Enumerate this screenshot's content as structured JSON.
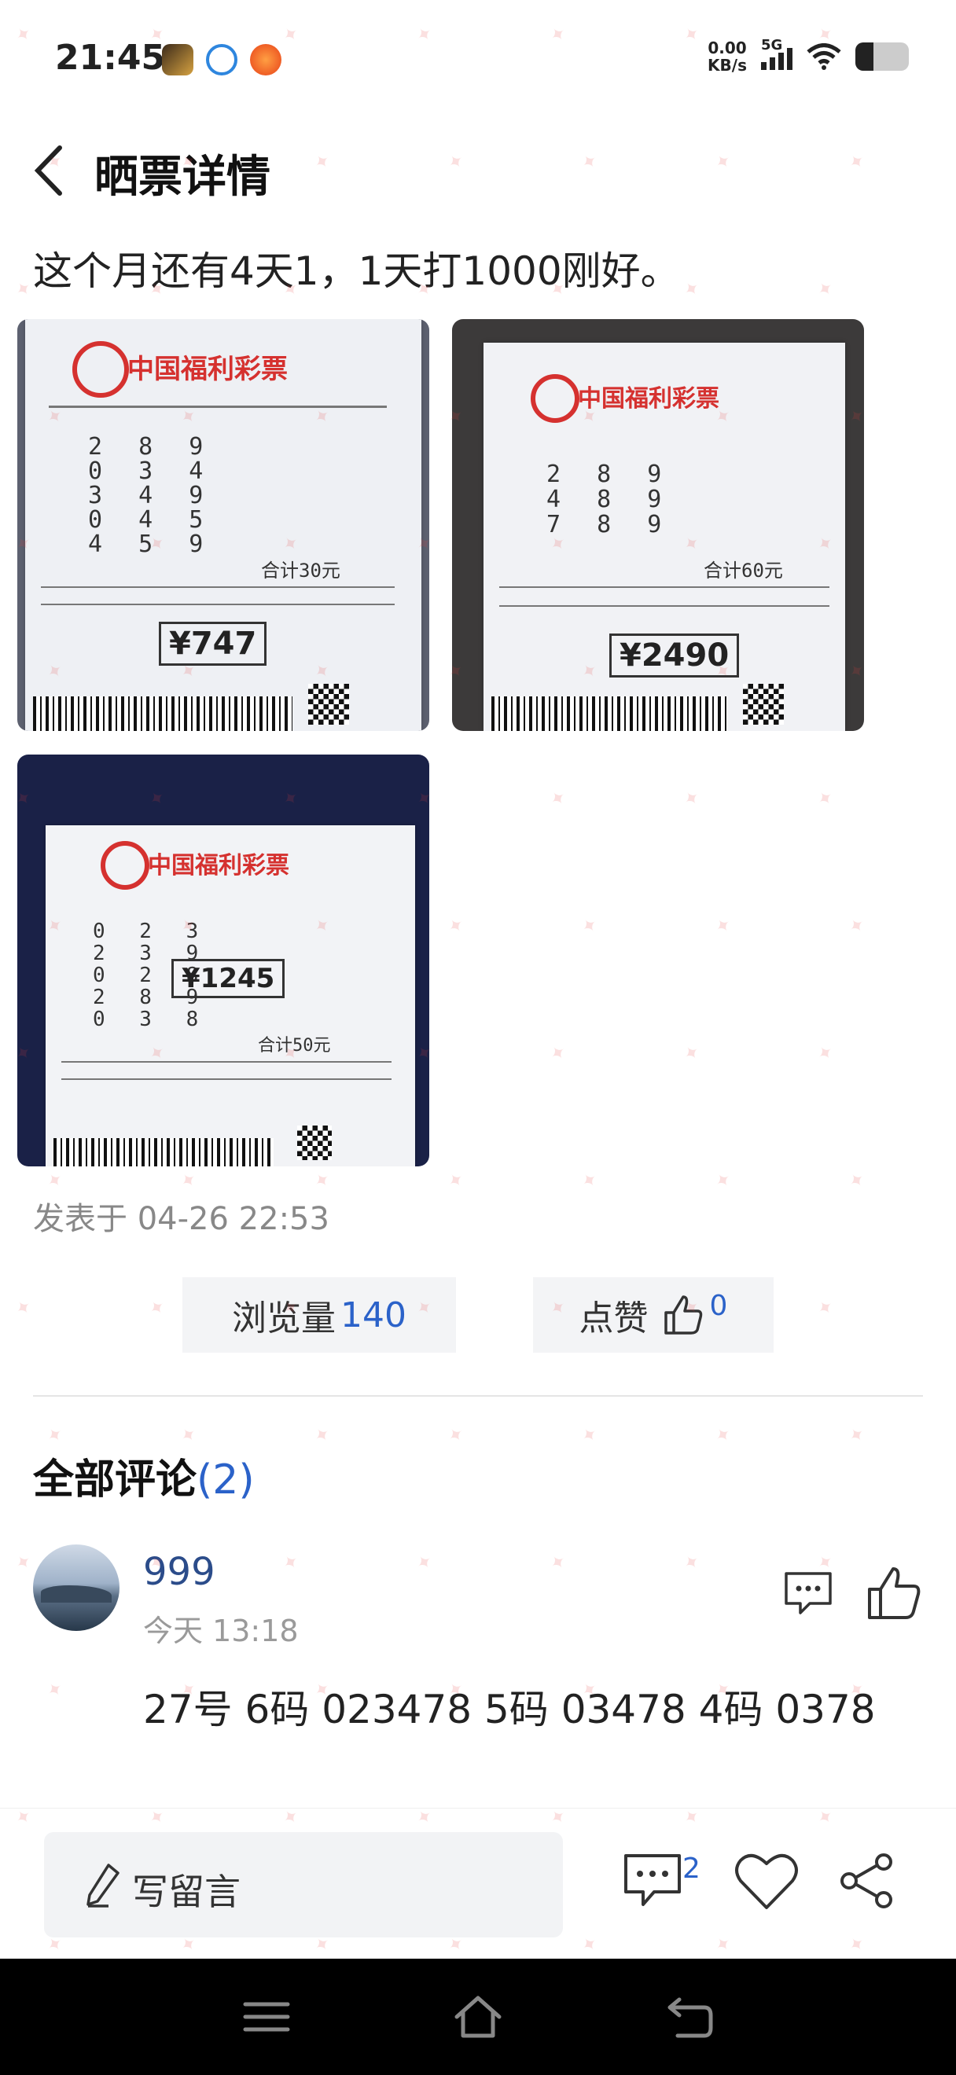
{
  "status_bar": {
    "time": "21:45",
    "net_speed_value": "0.00",
    "net_speed_unit": "KB/s",
    "signal_label": "5G",
    "battery_level": 0.34
  },
  "header": {
    "title": "晒票详情"
  },
  "post": {
    "text": "这个月还有4天1，1天打1000刚好。",
    "posted_label": "发表于",
    "posted_time": "04-26 22:53",
    "photos": [
      {
        "brand": "中国福利彩票",
        "numbers": [
          "2 8 9",
          "0 3 4",
          "3 4 9",
          "0 4 5",
          "4 5 9"
        ],
        "stamp": "¥747",
        "total": "合计30元"
      },
      {
        "brand": "中国福利彩票",
        "numbers": [
          "2 8 9",
          "4 8 9",
          "7 8 9"
        ],
        "stamp": "¥2490",
        "total": "合计60元"
      },
      {
        "brand": "中国福利彩票",
        "numbers": [
          "0 2 3",
          "2 3 9",
          "0 2 8",
          "2 8 9",
          "0 3 8"
        ],
        "stamp": "¥1245",
        "total": "合计50元"
      }
    ]
  },
  "stats": {
    "views_label": "浏览量",
    "views_count": "140",
    "likes_label": "点赞",
    "likes_count": "0"
  },
  "comments": {
    "title": "全部评论",
    "count": "(2)",
    "items": [
      {
        "name": "999",
        "time": "今天 13:18",
        "text": "27号 6码 023478 5码 03478 4码 0378"
      }
    ]
  },
  "bottom_bar": {
    "write_label": "写留言",
    "comment_count": "2"
  },
  "colors": {
    "accent": "#2b62c9",
    "brand_red": "#d5312f",
    "nav_bg": "#000000"
  },
  "icons": [
    "back-arrow-icon",
    "comment-bubble-icon",
    "thumbs-up-icon",
    "pen-icon",
    "heart-icon",
    "share-icon",
    "menu-icon",
    "home-icon",
    "return-icon"
  ]
}
